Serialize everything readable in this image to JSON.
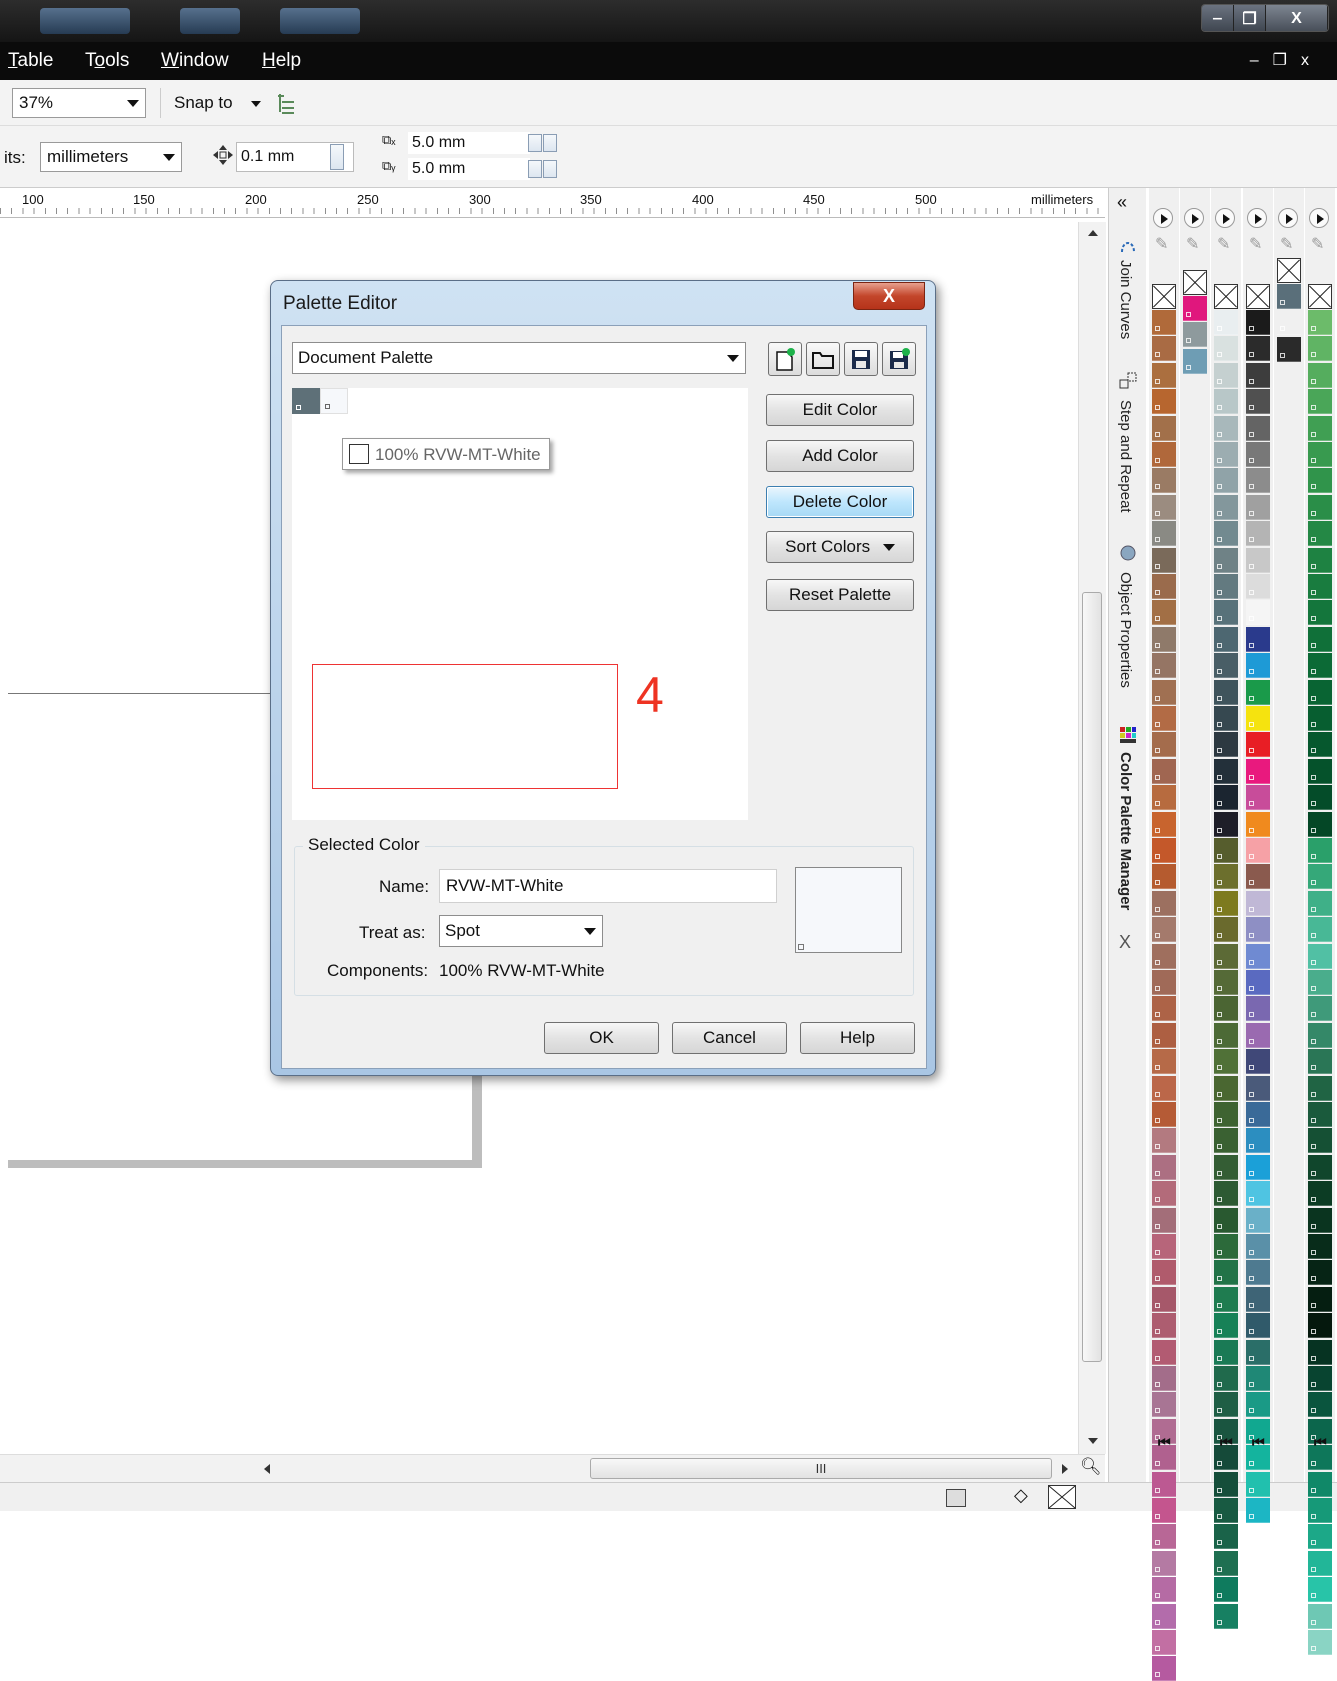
{
  "menubar": {
    "items": [
      {
        "label": "Table",
        "ul": "T",
        "rest": "able"
      },
      {
        "label": "Tools",
        "ul": "o",
        "pre": "T",
        "rest": "ols"
      },
      {
        "label": "Window",
        "ul": "W",
        "rest": "indow"
      },
      {
        "label": "Help",
        "ul": "H",
        "rest": "elp"
      }
    ]
  },
  "toolbar": {
    "zoom": "37%",
    "snap_to": "Snap to",
    "units_label": "its:",
    "units_value": "millimeters",
    "nudge": "0.1 mm",
    "dup_x": "5.0 mm",
    "dup_y": "5.0 mm"
  },
  "ruler": {
    "ticks": [
      "100",
      "150",
      "200",
      "250",
      "300",
      "350",
      "400",
      "450",
      "500"
    ],
    "unit": "millimeters"
  },
  "hscroll": {
    "thumb_grip": "III"
  },
  "docker": {
    "tabs": [
      "Join Curves",
      "Step and Repeat",
      "Object Properties",
      "Color Palette Manager"
    ]
  },
  "dialog": {
    "title": "Palette Editor",
    "close": "X",
    "palette_select": "Document Palette",
    "annotation": "4",
    "tooltip": "100% RVW-MT-White",
    "buttons": {
      "edit": "Edit Color",
      "add": "Add Color",
      "delete": "Delete Color",
      "sort": "Sort Colors",
      "reset": "Reset Palette",
      "ok": "OK",
      "cancel": "Cancel",
      "help": "Help"
    },
    "selected": {
      "group_label": "Selected Color",
      "name_label": "Name:",
      "name_value": "RVW-MT-White",
      "treat_label": "Treat as:",
      "treat_value": "Spot",
      "components_label": "Components:",
      "components_value": "100% RVW-MT-White"
    }
  },
  "palettes": [
    [
      "#b06a3a",
      "#a96b44",
      "#ab6f3f",
      "#b7662f",
      "#a2704a",
      "#b0683b",
      "#9a7b64",
      "#9b8c80",
      "#8a8a84",
      "#7a6a5a",
      "#9a6b4c",
      "#a26f45",
      "#8f7a6a",
      "#957564",
      "#a07052",
      "#b26b45",
      "#a46c4c",
      "#a06651",
      "#b76b3f",
      "#c8642e",
      "#c4582a",
      "#b55b2f",
      "#9c7060",
      "#a47a6c",
      "#9f6f5e",
      "#a06a58",
      "#ad6347",
      "#ad5f42",
      "#b66a48",
      "#bb6749",
      "#b55b36",
      "#b37a80",
      "#ac6f82",
      "#b36b7a",
      "#a36e79",
      "#b7657a",
      "#b05b6c",
      "#a6586a",
      "#ad5d70",
      "#b25b72",
      "#a36d8a",
      "#a87594",
      "#b06c92",
      "#b0618f",
      "#bc5992",
      "#c4558e",
      "#b86796",
      "#b47aa3",
      "#b56ba4",
      "#b36cab",
      "#c26fa3",
      "#b55aa0"
    ],
    [
      "#e0177d",
      "#8e9a9d",
      "#6e9db4"
    ],
    [
      "#e9eef0",
      "#d9e1e0",
      "#c5d0d0",
      "#b8c7c8",
      "#a8b8bb",
      "#9cadb1",
      "#90a3a8",
      "#83979c",
      "#728a90",
      "#6f8286",
      "#637a80",
      "#58727a",
      "#4d6771",
      "#495e66",
      "#3f545c",
      "#364850",
      "#2d3941",
      "#23303a",
      "#1b2530",
      "#1e1e28",
      "#565d2d",
      "#6c6f2d",
      "#7d7a1f",
      "#6a6a2d",
      "#5c6a36",
      "#556a37",
      "#4b6533",
      "#4c6a36",
      "#507137",
      "#4a6731",
      "#3e6331",
      "#3a6132",
      "#345d34",
      "#2d5a33",
      "#295930",
      "#2c6a3a",
      "#227347",
      "#1f7c50",
      "#178157",
      "#1a7a55",
      "#206a4c",
      "#1f5e45",
      "#1a5540",
      "#154a39",
      "#154e3a",
      "#185a42",
      "#1a6349",
      "#1f6f51",
      "#0f7b5e",
      "#178062"
    ],
    [
      "#1b1b1b",
      "#2b2b2b",
      "#3d3d3d",
      "#505050",
      "#646464",
      "#787878",
      "#8c8c8c",
      "#a0a0a0",
      "#b4b4b4",
      "#c8c8c8",
      "#dcdcdc",
      "#f5f5f5",
      "#2a3a8c",
      "#1e9ad6",
      "#1a9a4a",
      "#f5e30f",
      "#e81e25",
      "#e9197e",
      "#c84c9a",
      "#f08a1e",
      "#f6a1a6",
      "#8a5a4e",
      "#c0b8d6",
      "#8e8fc4",
      "#6f8ad2",
      "#5a6ac0",
      "#7a68b0",
      "#9a6ab0",
      "#404878",
      "#4a5a7a",
      "#3a6a98",
      "#2c8ec0",
      "#1ba0d8",
      "#4fc4e2",
      "#6ab0c8",
      "#5a90a8",
      "#4e7a90",
      "#3e6476",
      "#305a6a",
      "#2a6e68",
      "#1f8876",
      "#1a9a86",
      "#11a890",
      "#14b49e",
      "#21c0ae",
      "#1cb6c4"
    ],
    [
      "#5a6f7a",
      "#f0f0f0",
      "#2a2a2a"
    ],
    [
      "#6cbb6a",
      "#60b464",
      "#55ad5e",
      "#4aa658",
      "#409f53",
      "#389a4f",
      "#30944b",
      "#2a8e48",
      "#248845",
      "#1e8242",
      "#197c3f",
      "#14763c",
      "#107039",
      "#0c6a36",
      "#096433",
      "#075e30",
      "#06582e",
      "#05522b",
      "#044c29",
      "#044726",
      "#2aa06a",
      "#35a879",
      "#3fb088",
      "#48b896",
      "#51c0a4",
      "#4aad8c",
      "#3f9a7a",
      "#348868",
      "#2a7656",
      "#206444",
      "#1a5a3c",
      "#155034",
      "#10462c",
      "#0c3c24",
      "#0a341f",
      "#082c1a",
      "#062415",
      "#051e11",
      "#05180d",
      "#063322",
      "#084430",
      "#0a553e",
      "#0c664c",
      "#0e775a",
      "#108868",
      "#169978",
      "#1ca888",
      "#22b698",
      "#28c4a8",
      "#6ec8b4",
      "#8ad4c4"
    ]
  ]
}
